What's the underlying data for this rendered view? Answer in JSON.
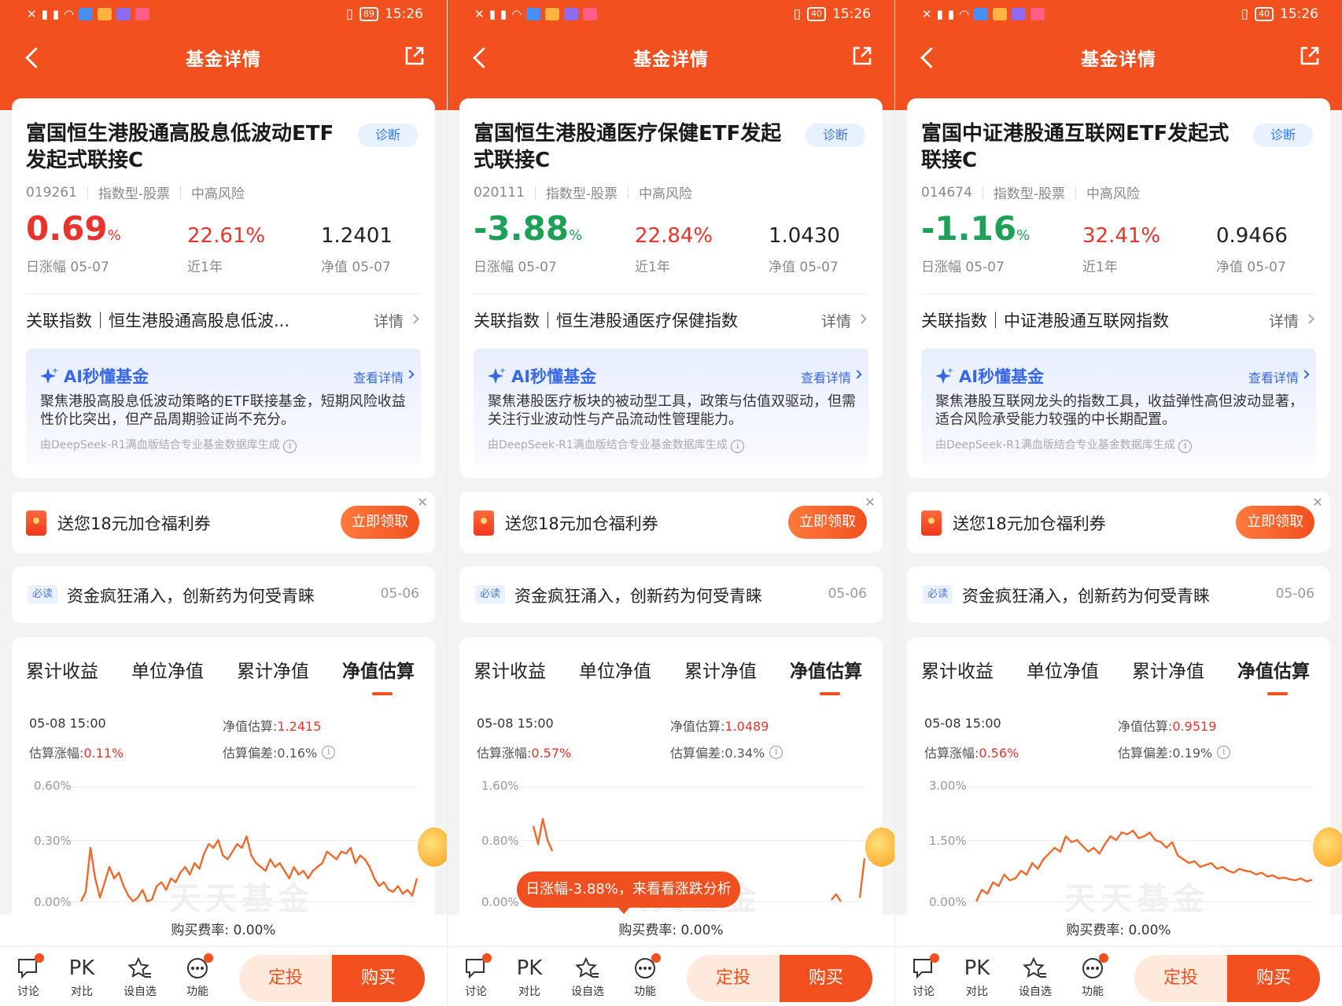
{
  "status": {
    "time": "15:26",
    "battery": [
      "89",
      "40",
      "40"
    ]
  },
  "nav": {
    "title": "基金详情"
  },
  "labels": {
    "day_change_prefix": "日涨幅",
    "one_year": "近1年",
    "nav_prefix": "净值",
    "index_prefix": "关联指数｜",
    "index_detail": "详情",
    "diag": "诊断",
    "ai_title": "AI秒懂基金",
    "ai_more": "查看详情",
    "ai_source": "由DeepSeek-R1满血版结合专业基金数据库生成",
    "coupon_text": "送您18元加仓福利券",
    "coupon_btn": "立即领取",
    "news_tag": "必读",
    "news_title": "资金疯狂涌入，创新药为何受青睐",
    "news_date": "05-06",
    "tabs": [
      "累计收益",
      "单位净值",
      "累计净值",
      "净值估算"
    ],
    "est_nav": "净值估算:",
    "est_change": "估算涨幅:",
    "est_deviation": "估算偏差:",
    "fee": "购买费率: 0.00%",
    "watermark": "天天基金",
    "bottom": [
      "讨论",
      "对比",
      "设自选",
      "功能"
    ],
    "pk": "PK",
    "dingtou": "定投",
    "buy": "购买"
  },
  "funds": [
    {
      "name": "富国恒生港股通高股息低波动ETF发起式联接C",
      "code": "019261",
      "type": "指数型-股票",
      "risk": "中高风险",
      "day_change": "0.69",
      "day_change_dir": "up",
      "date": "05-07",
      "one_year": "22.61%",
      "nav": "1.2401",
      "index": "恒生港股通高股息低波...",
      "ai_text": "聚焦港股高股息低波动策略的ETF联接基金，短期风险收益性价比突出，但产品周期验证尚不充分。",
      "est_time": "05-08 15:00",
      "est_nav": "1.2415",
      "est_change": "0.11%",
      "est_deviation": "0.16%",
      "y_labels": [
        "0.60%",
        "0.30%",
        "0.00%"
      ],
      "toast": "",
      "chart_data": {
        "type": "line",
        "y_range": [
          0,
          0.6
        ],
        "values": [
          0.0,
          0.05,
          0.28,
          0.12,
          0.02,
          0.1,
          0.18,
          0.12,
          0.15,
          0.08,
          0.03,
          0.0,
          0.02,
          0.06,
          0.0,
          0.01,
          0.08,
          0.1,
          0.06,
          0.12,
          0.1,
          0.15,
          0.18,
          0.14,
          0.2,
          0.17,
          0.25,
          0.3,
          0.28,
          0.32,
          0.24,
          0.22,
          0.26,
          0.3,
          0.28,
          0.34,
          0.24,
          0.2,
          0.18,
          0.16,
          0.22,
          0.18,
          0.2,
          0.16,
          0.12,
          0.18,
          0.14,
          0.16,
          0.12,
          0.16,
          0.18,
          0.2,
          0.26,
          0.24,
          0.22,
          0.26,
          0.25,
          0.28,
          0.2,
          0.24,
          0.22,
          0.18,
          0.12,
          0.08,
          0.1,
          0.06,
          0.05,
          0.08,
          0.04,
          0.06,
          0.03,
          0.12
        ]
      }
    },
    {
      "name": "富国恒生港股通医疗保健ETF发起式联接C",
      "code": "020111",
      "type": "指数型-股票",
      "risk": "中高风险",
      "day_change": "-3.88",
      "day_change_dir": "down",
      "date": "05-07",
      "one_year": "22.84%",
      "nav": "1.0430",
      "index": "恒生港股通医疗保健指数",
      "ai_text": "聚焦港股医疗板块的被动型工具，政策与估值双驱动，但需关注行业波动性与产品流动性管理能力。",
      "est_time": "05-08 15:00",
      "est_nav": "1.0489",
      "est_change": "0.57%",
      "est_deviation": "0.34%",
      "y_labels": [
        "1.60%",
        "0.80%",
        "0.00%"
      ],
      "toast": "日涨幅-3.88%，来看看涨跌分析",
      "chart_data": {
        "type": "line",
        "y_range": [
          0,
          1.6
        ],
        "values": [
          null,
          1.05,
          0.8,
          1.15,
          0.85,
          0.7,
          null,
          null,
          null,
          null,
          null,
          null,
          null,
          null,
          null,
          null,
          null,
          null,
          null,
          null,
          null,
          null,
          null,
          null,
          null,
          null,
          null,
          null,
          null,
          null,
          null,
          null,
          null,
          null,
          null,
          null,
          null,
          null,
          null,
          null,
          null,
          null,
          null,
          null,
          null,
          null,
          null,
          null,
          null,
          null,
          null,
          null,
          null,
          null,
          null,
          null,
          null,
          null,
          null,
          null,
          null,
          null,
          null,
          null,
          0.02,
          0.1,
          0.0,
          null,
          null,
          null,
          0.05,
          0.6
        ]
      }
    },
    {
      "name": "富国中证港股通互联网ETF发起式联接C",
      "code": "014674",
      "type": "指数型-股票",
      "risk": "中高风险",
      "day_change": "-1.16",
      "day_change_dir": "down",
      "date": "05-07",
      "one_year": "32.41%",
      "nav": "0.9466",
      "index": "中证港股通互联网指数",
      "ai_text": "聚焦港股互联网龙头的指数工具，收益弹性高但波动显著，适合风险承受能力较强的中长期配置。",
      "est_time": "05-08 15:00",
      "est_nav": "0.9519",
      "est_change": "0.56%",
      "est_deviation": "0.19%",
      "y_labels": [
        "3.00%",
        "1.50%",
        "0.00%"
      ],
      "toast": "",
      "chart_data": {
        "type": "line",
        "y_range": [
          0,
          3.0
        ],
        "values": [
          0.0,
          0.3,
          0.2,
          0.5,
          0.4,
          0.7,
          0.55,
          0.6,
          0.8,
          0.7,
          1.0,
          0.85,
          1.1,
          1.25,
          1.4,
          1.3,
          1.7,
          1.55,
          1.6,
          1.45,
          1.3,
          1.4,
          1.25,
          1.5,
          1.7,
          1.6,
          1.8,
          1.75,
          1.85,
          1.65,
          1.7,
          1.8,
          1.6,
          1.55,
          1.4,
          1.55,
          1.2,
          1.1,
          1.0,
          1.05,
          0.9,
          0.95,
          1.0,
          0.85,
          0.9,
          0.8,
          0.75,
          0.85,
          0.8,
          0.78,
          0.7,
          0.75,
          0.65,
          0.68,
          0.6,
          0.62,
          0.58,
          0.55,
          0.6,
          0.52,
          0.56
        ]
      }
    }
  ]
}
